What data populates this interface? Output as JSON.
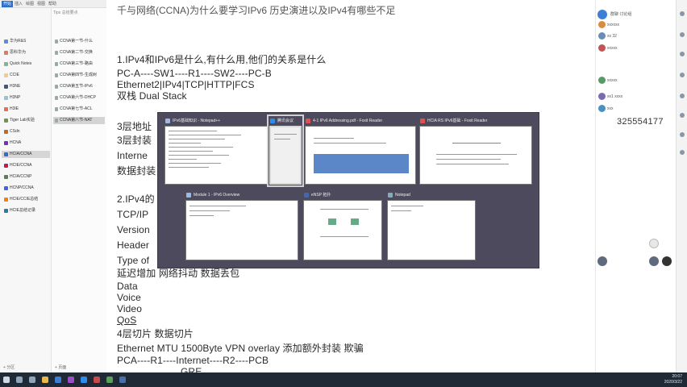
{
  "menubar": [
    "开始",
    "插入",
    "绘图",
    "视图",
    "帮助"
  ],
  "sidebar": {
    "items": [
      "华为R&S",
      "思科华为",
      "Quick Notes",
      "CCIE",
      "H3NE",
      "H3NP",
      "H3IE",
      "Tiger Lab实验",
      "CSdn",
      "HCNA",
      "HCIA/CCNA",
      "HCIE/CCNA",
      "HCIA/CCNP",
      "HCNP/CCNA",
      "HCIE/CCIE总结",
      "HCIE总结记录"
    ],
    "add_notebook": "+ 分区"
  },
  "pages": {
    "search": "Tips 总结要点",
    "items": [
      "CCNA第一节-什么",
      "CCNA第二节-交换",
      "CCNA第三节-路由",
      "CCNA第四节-生成树",
      "CCNA第五节-IPv6",
      "CCNA第六节-DHCP",
      "CCNA第七节-ACL",
      "CCNA第八节-NAT"
    ],
    "add_page": "+ 页面"
  },
  "note": {
    "top_partial": "千与网络(CCNA)为什么要学习IPv6 历史演进以及IPv4有哪些不足",
    "lines": [
      "1.IPv4和IPv6是什么,有什么用,他们的关系是什么",
      "PC-A----SW1----R1----SW2----PC-B",
      "Ethernet2|IPv4|TCP|HTTP|FCS",
      "双栈 Dual Stack",
      "3层地址",
      "3层封装",
      "Interne",
      "数据封装",
      "2.IPv4的",
      "TCP/IP",
      "Version",
      "Header",
      "Type of",
      "延迟增加 网络抖动 数据丢包",
      "Data",
      "Voice",
      "Video",
      "QoS",
      "4层切片 数据切片",
      "Ethernet MTU 1500Byte  VPN overlay 添加额外封装 欺骗",
      "PCA----R1----Internet----R2----PCB",
      "GRE"
    ]
  },
  "switcher": {
    "windows": [
      {
        "title": "IPv6基础知识 - Notepad++"
      },
      {
        "title": "腾讯会议"
      },
      {
        "title": "4-1 IPv6 Addressing.pdf - Foxit Reader"
      },
      {
        "title": "HCIA RS IPv6基础 - Foxit Reader"
      },
      {
        "title": "Module 1 - IPv6 Overview"
      },
      {
        "title": "eNSP 拓扑"
      },
      {
        "title": "Notepad"
      }
    ]
  },
  "right_panel": {
    "rows": [
      "群聊 讨论组",
      "xxxxxx",
      "xx 32",
      "xxxxx",
      "xxxxx",
      "xx1 xxxx",
      "xxx"
    ],
    "qq_number": "325554177"
  },
  "taskbar": {
    "time": "20:07",
    "date": "2020/3/22"
  }
}
